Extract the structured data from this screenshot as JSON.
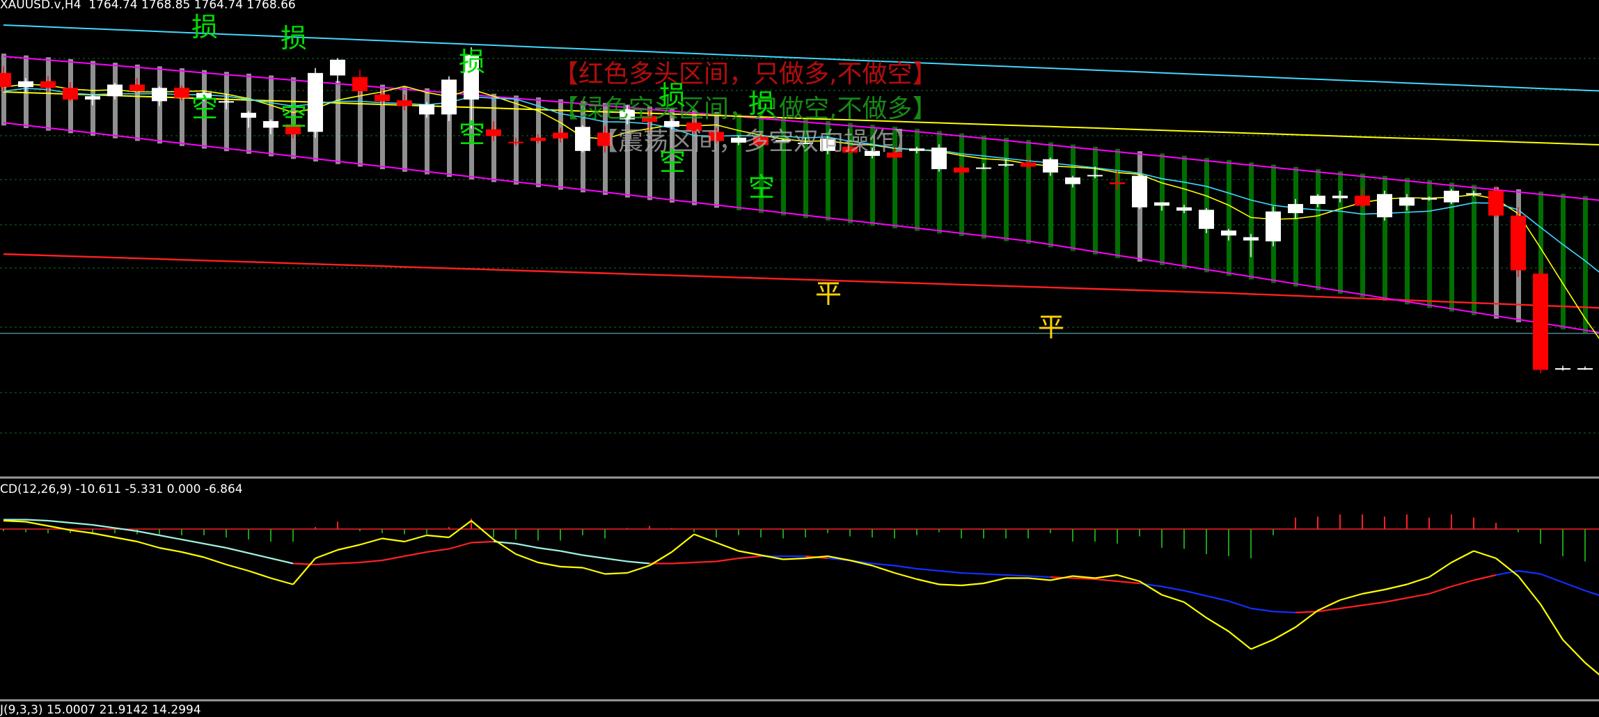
{
  "header": {
    "symbol_line": "XAUUSD.v,H4  1764.74 1768.85 1764.74 1768.66",
    "macd_line": "CD(12,26,9) -10.611 -5.331 0.000 -6.864",
    "third_line": "J(9,3,3) 15.0007 21.9142 14.2994"
  },
  "annotations": {
    "red_zone_text": "【红色多头区间，只做多,不做空】",
    "green_zone_text": "【绿色空头区间，只做空,不做多】",
    "gray_zone_text": "【震荡区间，多空双向操作】",
    "stop_label": "损",
    "short_label": "空",
    "flat_label": "平"
  },
  "colors": {
    "background": "#000000",
    "up_candle": "#ffffff",
    "down_candle": "#ff0000",
    "zone_gray": "#a0a0a0",
    "zone_green": "#007a00",
    "signal_green": "#00e000",
    "signal_yellow": "#ffd400",
    "band_magenta": "#ff00ff",
    "ma_cyan": "#00c8ff",
    "ma_yellow": "#ffff00",
    "ma_red": "#ff2020",
    "line_cyan": "#40d8ff"
  },
  "chart_data": [
    {
      "type": "candlestick",
      "symbol": "XAUUSD.v",
      "timeframe": "H4",
      "ohlc_last": [
        1764.74,
        1768.85,
        1764.74,
        1768.66
      ],
      "candles": [
        [
          1778.2,
          1779.0,
          1776.0,
          1776.5
        ],
        [
          1776.5,
          1777.6,
          1775.8,
          1777.2
        ],
        [
          1777.2,
          1777.8,
          1775.9,
          1776.4
        ],
        [
          1776.4,
          1777.1,
          1774.8,
          1775.0
        ],
        [
          1775.0,
          1775.6,
          1774.3,
          1775.4
        ],
        [
          1775.4,
          1777.0,
          1775.0,
          1776.8
        ],
        [
          1776.8,
          1777.6,
          1775.9,
          1776.0
        ],
        [
          1774.8,
          1776.6,
          1774.2,
          1776.4
        ],
        [
          1776.4,
          1776.7,
          1774.9,
          1775.2
        ],
        [
          1775.2,
          1776.1,
          1774.8,
          1775.8
        ],
        [
          1774.7,
          1775.7,
          1773.8,
          1774.8
        ],
        [
          1772.8,
          1773.6,
          1771.6,
          1773.4
        ],
        [
          1771.6,
          1772.6,
          1770.8,
          1772.4
        ],
        [
          1772.0,
          1772.8,
          1770.3,
          1770.8
        ],
        [
          1771.1,
          1778.8,
          1770.4,
          1778.2
        ],
        [
          1777.9,
          1780.0,
          1777.0,
          1779.8
        ],
        [
          1777.7,
          1778.6,
          1775.5,
          1776.0
        ],
        [
          1775.6,
          1776.2,
          1774.4,
          1774.8
        ],
        [
          1774.9,
          1775.6,
          1773.7,
          1774.2
        ],
        [
          1773.2,
          1774.7,
          1772.8,
          1774.4
        ],
        [
          1773.2,
          1777.8,
          1772.4,
          1777.4
        ],
        [
          1775.0,
          1781.3,
          1771.5,
          1780.4
        ],
        [
          1771.4,
          1772.4,
          1770.0,
          1770.6
        ],
        [
          1769.9,
          1770.4,
          1769.4,
          1769.8
        ],
        [
          1770.4,
          1770.8,
          1769.7,
          1770.0
        ],
        [
          1771.0,
          1771.6,
          1769.8,
          1770.3
        ],
        [
          1768.8,
          1771.9,
          1768.6,
          1771.7
        ],
        [
          1771.0,
          1771.8,
          1768.6,
          1769.4
        ],
        [
          1772.6,
          1774.3,
          1772.0,
          1773.8
        ],
        [
          1773.0,
          1773.8,
          1771.0,
          1772.3
        ],
        [
          1771.7,
          1772.7,
          1771.4,
          1772.4
        ],
        [
          1772.2,
          1773.0,
          1770.8,
          1771.2
        ],
        [
          1771.1,
          1771.6,
          1769.7,
          1770.0
        ],
        [
          1769.8,
          1770.6,
          1769.5,
          1770.4
        ],
        [
          1770.5,
          1770.7,
          1769.4,
          1769.5
        ],
        [
          1770.0,
          1770.3,
          1770.1,
          1770.1
        ],
        [
          1769.8,
          1770.4,
          1769.7,
          1769.8
        ],
        [
          1768.8,
          1770.6,
          1768.4,
          1770.3
        ],
        [
          1769.3,
          1769.4,
          1768.4,
          1768.6
        ],
        [
          1768.2,
          1769.2,
          1767.9,
          1768.8
        ],
        [
          1768.6,
          1769.3,
          1767.8,
          1768.0
        ],
        [
          1768.8,
          1769.3,
          1768.5,
          1769.1
        ],
        [
          1766.6,
          1769.6,
          1766.3,
          1769.2
        ],
        [
          1766.8,
          1767.1,
          1765.9,
          1766.2
        ],
        [
          1766.8,
          1767.3,
          1766.6,
          1766.8
        ],
        [
          1767.2,
          1767.8,
          1766.9,
          1767.2
        ],
        [
          1767.4,
          1768.0,
          1766.7,
          1766.9
        ],
        [
          1766.2,
          1768.0,
          1765.8,
          1767.8
        ],
        [
          1764.8,
          1765.8,
          1764.4,
          1765.6
        ],
        [
          1765.9,
          1766.9,
          1765.5,
          1765.9
        ],
        [
          1765.0,
          1766.4,
          1764.1,
          1764.8
        ],
        [
          1762.0,
          1766.0,
          1761.8,
          1765.8
        ],
        [
          1762.2,
          1762.6,
          1761.6,
          1762.6
        ],
        [
          1761.6,
          1762.3,
          1761.3,
          1762.0
        ],
        [
          1759.4,
          1761.9,
          1758.9,
          1761.7
        ],
        [
          1758.6,
          1759.4,
          1758.0,
          1759.2
        ],
        [
          1758.0,
          1758.8,
          1756.0,
          1758.4
        ],
        [
          1757.9,
          1762.1,
          1757.3,
          1761.5
        ],
        [
          1761.3,
          1763.0,
          1760.6,
          1762.4
        ],
        [
          1762.4,
          1763.6,
          1762.0,
          1763.4
        ],
        [
          1763.1,
          1764.0,
          1762.6,
          1763.4
        ],
        [
          1763.4,
          1764.3,
          1761.9,
          1762.2
        ],
        [
          1760.8,
          1764.0,
          1760.4,
          1763.6
        ],
        [
          1762.2,
          1763.6,
          1761.6,
          1763.2
        ],
        [
          1763.0,
          1763.3,
          1762.8,
          1763.1
        ],
        [
          1762.6,
          1764.2,
          1762.4,
          1764.0
        ],
        [
          1763.6,
          1764.0,
          1763.3,
          1763.7
        ],
        [
          1764.0,
          1764.6,
          1760.8,
          1761.0
        ],
        [
          1761.0,
          1762.0,
          1753.6,
          1754.4
        ],
        [
          1754.0,
          1754.6,
          1742.0,
          1742.4
        ],
        [
          1742.5,
          1742.9,
          1742.3,
          1742.6
        ],
        [
          1742.6,
          1742.8,
          1742.4,
          1742.6
        ],
        [
          1744.2,
          1744.3,
          1741.6,
          1742.0
        ]
      ],
      "price_range": [
        1729.5,
        1787.0
      ],
      "resistance_level": 1746.8
    },
    {
      "type": "line",
      "indicator": "MACD",
      "params": [
        12,
        26,
        9
      ],
      "values": [
        -10.611,
        -5.331,
        0.0,
        -6.864
      ],
      "histogram": [
        -0.2,
        -0.3,
        -0.4,
        -0.4,
        -0.5,
        -0.4,
        -0.5,
        -0.5,
        -0.6,
        -0.6,
        -0.8,
        -1.0,
        -1.2,
        -1.2,
        0.2,
        0.7,
        -0.2,
        -0.4,
        -0.5,
        -0.5,
        0.2,
        1.0,
        -0.8,
        -1.0,
        -1.1,
        -1.1,
        -0.6,
        -0.9,
        0.1,
        0.3,
        0.1,
        -0.3,
        -0.8,
        -0.6,
        -0.8,
        -0.9,
        -0.8,
        -0.4,
        -0.7,
        -0.8,
        -0.9,
        -0.6,
        -0.3,
        -0.9,
        -0.9,
        -0.9,
        -0.9,
        -0.4,
        -1.2,
        -1.2,
        -1.4,
        -0.7,
        -1.8,
        -1.9,
        -2.4,
        -2.6,
        -2.8,
        -0.6,
        1.1,
        1.2,
        1.4,
        1.4,
        1.2,
        1.4,
        1.1,
        1.4,
        1.1,
        0.6,
        -0.3,
        -1.4,
        -2.6,
        -3.1,
        -3.4
      ],
      "macd_line": [
        0.8,
        0.7,
        0.3,
        -0.1,
        -0.4,
        -0.8,
        -1.2,
        -1.8,
        -2.2,
        -2.7,
        -3.4,
        -4.0,
        -4.7,
        -5.3,
        -2.8,
        -2.0,
        -1.5,
        -0.9,
        -1.2,
        -0.6,
        -0.8,
        0.8,
        -1.0,
        -2.4,
        -3.2,
        -3.6,
        -3.7,
        -4.3,
        -4.2,
        -3.5,
        -2.2,
        -0.5,
        -1.3,
        -2.1,
        -2.5,
        -2.9,
        -2.8,
        -2.6,
        -3.0,
        -3.5,
        -4.2,
        -4.8,
        -5.3,
        -5.4,
        -5.2,
        -4.7,
        -4.7,
        -4.9,
        -4.5,
        -4.7,
        -4.4,
        -5.0,
        -6.3,
        -7.0,
        -8.5,
        -9.8,
        -11.5,
        -10.6,
        -9.4,
        -7.8,
        -6.8,
        -6.2,
        -5.8,
        -5.3,
        -4.6,
        -3.2,
        -2.1,
        -2.8,
        -4.5,
        -7.2,
        -10.6,
        -12.8,
        -14.6
      ],
      "signal_line": [
        0.9,
        0.9,
        0.8,
        0.6,
        0.4,
        0.1,
        -0.2,
        -0.6,
        -1.0,
        -1.4,
        -1.8,
        -2.3,
        -2.8,
        -3.3,
        -3.4,
        -3.3,
        -3.2,
        -3.0,
        -2.6,
        -2.2,
        -1.9,
        -1.3,
        -1.2,
        -1.4,
        -1.8,
        -2.1,
        -2.5,
        -2.8,
        -3.1,
        -3.3,
        -3.3,
        -3.2,
        -3.1,
        -2.8,
        -2.6,
        -2.6,
        -2.6,
        -2.8,
        -3.0,
        -3.3,
        -3.5,
        -3.8,
        -4.0,
        -4.2,
        -4.3,
        -4.4,
        -4.5,
        -4.6,
        -4.7,
        -4.8,
        -5.0,
        -5.2,
        -5.5,
        -5.9,
        -6.4,
        -6.9,
        -7.6,
        -7.9,
        -8.0,
        -7.9,
        -7.6,
        -7.3,
        -7.0,
        -6.6,
        -6.2,
        -5.5,
        -4.9,
        -4.4,
        -4.0,
        -4.3,
        -5.1,
        -5.9,
        -6.6
      ],
      "range": [
        -16.0,
        4.0
      ]
    }
  ]
}
